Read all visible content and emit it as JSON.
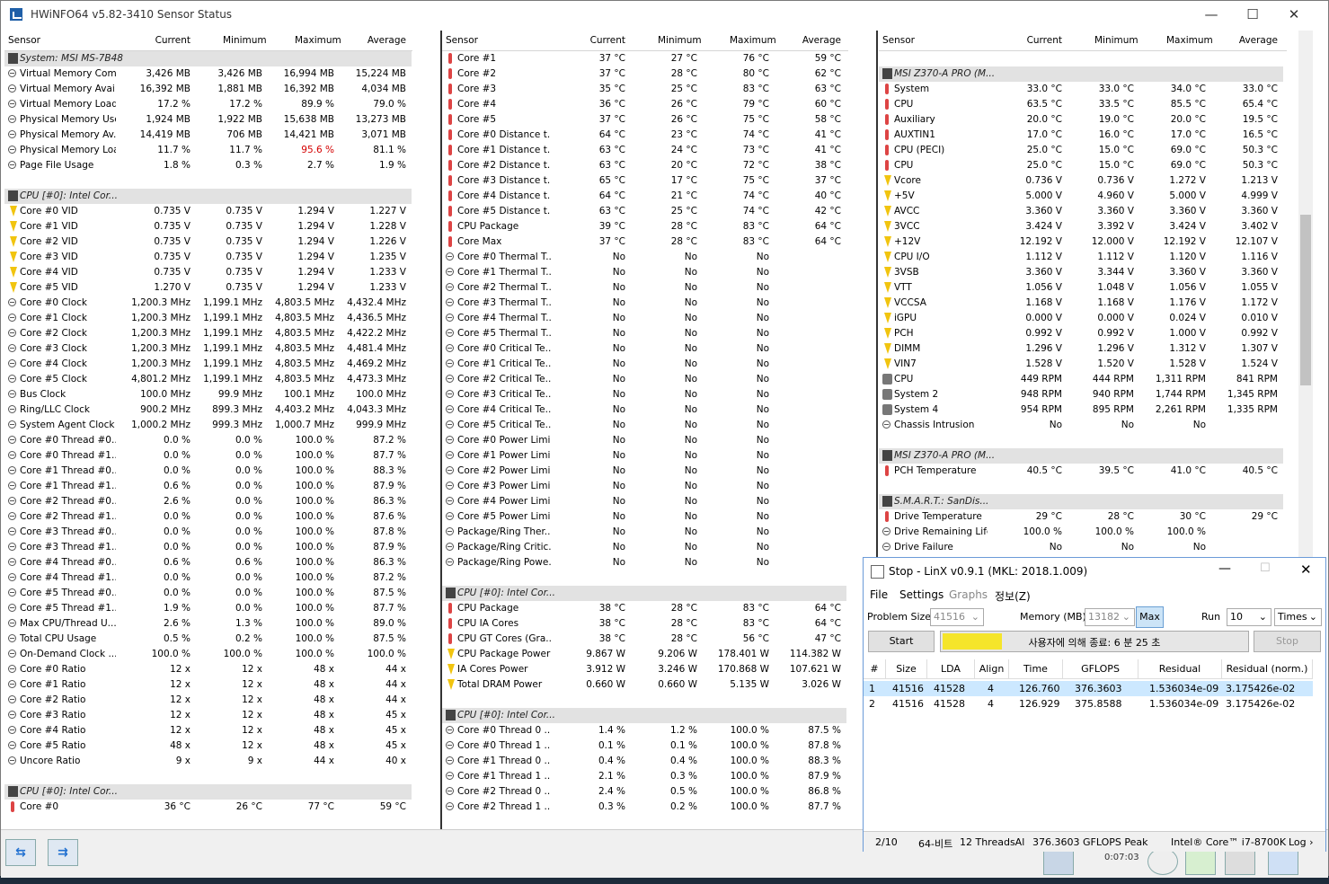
{
  "window": {
    "title": "HWiNFO64 v5.82-3410 Sensor Status",
    "minimize": "—",
    "maximize": "☐",
    "close": "✕"
  },
  "columns": {
    "sensor": "Sensor",
    "current": "Current",
    "minimum": "Minimum",
    "maximum": "Maximum",
    "average": "Average"
  },
  "pane1": [
    {
      "n": "System: MSI MS-7B48",
      "g": 1
    },
    {
      "n": "Virtual Memory Com...",
      "i": "circ",
      "c": "3,426 MB",
      "mn": "3,426 MB",
      "mx": "16,994 MB",
      "a": "15,224 MB"
    },
    {
      "n": "Virtual Memory Avai...",
      "i": "circ",
      "c": "16,392 MB",
      "mn": "1,881 MB",
      "mx": "16,392 MB",
      "a": "4,034 MB"
    },
    {
      "n": "Virtual Memory Load",
      "i": "circ",
      "c": "17.2 %",
      "mn": "17.2 %",
      "mx": "89.9 %",
      "a": "79.0 %"
    },
    {
      "n": "Physical Memory Used",
      "i": "circ",
      "c": "1,924 MB",
      "mn": "1,922 MB",
      "mx": "15,638 MB",
      "a": "13,273 MB"
    },
    {
      "n": "Physical Memory Av...",
      "i": "circ",
      "c": "14,419 MB",
      "mn": "706 MB",
      "mx": "14,421 MB",
      "a": "3,071 MB"
    },
    {
      "n": "Physical Memory Load",
      "i": "circ",
      "c": "11.7 %",
      "mn": "11.7 %",
      "mx": "95.6 %",
      "a": "81.1 %",
      "mxred": 1
    },
    {
      "n": "Page File Usage",
      "i": "circ",
      "c": "1.8 %",
      "mn": "0.3 %",
      "mx": "2.7 %",
      "a": "1.9 %"
    },
    {
      "n": "",
      "e": 1
    },
    {
      "n": "CPU [#0]: Intel Cor...",
      "g": 1
    },
    {
      "n": "Core #0 VID",
      "i": "volt",
      "c": "0.735 V",
      "mn": "0.735 V",
      "mx": "1.294 V",
      "a": "1.227 V"
    },
    {
      "n": "Core #1 VID",
      "i": "volt",
      "c": "0.735 V",
      "mn": "0.735 V",
      "mx": "1.294 V",
      "a": "1.228 V"
    },
    {
      "n": "Core #2 VID",
      "i": "volt",
      "c": "0.735 V",
      "mn": "0.735 V",
      "mx": "1.294 V",
      "a": "1.226 V"
    },
    {
      "n": "Core #3 VID",
      "i": "volt",
      "c": "0.735 V",
      "mn": "0.735 V",
      "mx": "1.294 V",
      "a": "1.235 V"
    },
    {
      "n": "Core #4 VID",
      "i": "volt",
      "c": "0.735 V",
      "mn": "0.735 V",
      "mx": "1.294 V",
      "a": "1.233 V"
    },
    {
      "n": "Core #5 VID",
      "i": "volt",
      "c": "1.270 V",
      "mn": "0.735 V",
      "mx": "1.294 V",
      "a": "1.233 V"
    },
    {
      "n": "Core #0 Clock",
      "i": "circ",
      "c": "1,200.3 MHz",
      "mn": "1,199.1 MHz",
      "mx": "4,803.5 MHz",
      "a": "4,432.4 MHz"
    },
    {
      "n": "Core #1 Clock",
      "i": "circ",
      "c": "1,200.3 MHz",
      "mn": "1,199.1 MHz",
      "mx": "4,803.5 MHz",
      "a": "4,436.5 MHz"
    },
    {
      "n": "Core #2 Clock",
      "i": "circ",
      "c": "1,200.3 MHz",
      "mn": "1,199.1 MHz",
      "mx": "4,803.5 MHz",
      "a": "4,422.2 MHz"
    },
    {
      "n": "Core #3 Clock",
      "i": "circ",
      "c": "1,200.3 MHz",
      "mn": "1,199.1 MHz",
      "mx": "4,803.5 MHz",
      "a": "4,481.4 MHz"
    },
    {
      "n": "Core #4 Clock",
      "i": "circ",
      "c": "1,200.3 MHz",
      "mn": "1,199.1 MHz",
      "mx": "4,803.5 MHz",
      "a": "4,469.2 MHz"
    },
    {
      "n": "Core #5 Clock",
      "i": "circ",
      "c": "4,801.2 MHz",
      "mn": "1,199.1 MHz",
      "mx": "4,803.5 MHz",
      "a": "4,473.3 MHz"
    },
    {
      "n": "Bus Clock",
      "i": "circ",
      "c": "100.0 MHz",
      "mn": "99.9 MHz",
      "mx": "100.1 MHz",
      "a": "100.0 MHz"
    },
    {
      "n": "Ring/LLC Clock",
      "i": "circ",
      "c": "900.2 MHz",
      "mn": "899.3 MHz",
      "mx": "4,403.2 MHz",
      "a": "4,043.3 MHz"
    },
    {
      "n": "System Agent Clock",
      "i": "circ",
      "c": "1,000.2 MHz",
      "mn": "999.3 MHz",
      "mx": "1,000.7 MHz",
      "a": "999.9 MHz"
    },
    {
      "n": "Core #0 Thread #0...",
      "i": "circ",
      "c": "0.0 %",
      "mn": "0.0 %",
      "mx": "100.0 %",
      "a": "87.2 %"
    },
    {
      "n": "Core #0 Thread #1...",
      "i": "circ",
      "c": "0.0 %",
      "mn": "0.0 %",
      "mx": "100.0 %",
      "a": "87.7 %"
    },
    {
      "n": "Core #1 Thread #0...",
      "i": "circ",
      "c": "0.0 %",
      "mn": "0.0 %",
      "mx": "100.0 %",
      "a": "88.3 %"
    },
    {
      "n": "Core #1 Thread #1...",
      "i": "circ",
      "c": "0.6 %",
      "mn": "0.0 %",
      "mx": "100.0 %",
      "a": "87.9 %"
    },
    {
      "n": "Core #2 Thread #0...",
      "i": "circ",
      "c": "2.6 %",
      "mn": "0.0 %",
      "mx": "100.0 %",
      "a": "86.3 %"
    },
    {
      "n": "Core #2 Thread #1...",
      "i": "circ",
      "c": "0.0 %",
      "mn": "0.0 %",
      "mx": "100.0 %",
      "a": "87.6 %"
    },
    {
      "n": "Core #3 Thread #0...",
      "i": "circ",
      "c": "0.0 %",
      "mn": "0.0 %",
      "mx": "100.0 %",
      "a": "87.8 %"
    },
    {
      "n": "Core #3 Thread #1...",
      "i": "circ",
      "c": "0.0 %",
      "mn": "0.0 %",
      "mx": "100.0 %",
      "a": "87.9 %"
    },
    {
      "n": "Core #4 Thread #0...",
      "i": "circ",
      "c": "0.6 %",
      "mn": "0.6 %",
      "mx": "100.0 %",
      "a": "86.3 %"
    },
    {
      "n": "Core #4 Thread #1...",
      "i": "circ",
      "c": "0.0 %",
      "mn": "0.0 %",
      "mx": "100.0 %",
      "a": "87.2 %"
    },
    {
      "n": "Core #5 Thread #0...",
      "i": "circ",
      "c": "0.0 %",
      "mn": "0.0 %",
      "mx": "100.0 %",
      "a": "87.5 %"
    },
    {
      "n": "Core #5 Thread #1...",
      "i": "circ",
      "c": "1.9 %",
      "mn": "0.0 %",
      "mx": "100.0 %",
      "a": "87.7 %"
    },
    {
      "n": "Max CPU/Thread U...",
      "i": "circ",
      "c": "2.6 %",
      "mn": "1.3 %",
      "mx": "100.0 %",
      "a": "89.0 %"
    },
    {
      "n": "Total CPU Usage",
      "i": "circ",
      "c": "0.5 %",
      "mn": "0.2 %",
      "mx": "100.0 %",
      "a": "87.5 %"
    },
    {
      "n": "On-Demand Clock ...",
      "i": "circ",
      "c": "100.0 %",
      "mn": "100.0 %",
      "mx": "100.0 %",
      "a": "100.0 %"
    },
    {
      "n": "Core #0 Ratio",
      "i": "circ",
      "c": "12 x",
      "mn": "12 x",
      "mx": "48 x",
      "a": "44 x"
    },
    {
      "n": "Core #1 Ratio",
      "i": "circ",
      "c": "12 x",
      "mn": "12 x",
      "mx": "48 x",
      "a": "44 x"
    },
    {
      "n": "Core #2 Ratio",
      "i": "circ",
      "c": "12 x",
      "mn": "12 x",
      "mx": "48 x",
      "a": "44 x"
    },
    {
      "n": "Core #3 Ratio",
      "i": "circ",
      "c": "12 x",
      "mn": "12 x",
      "mx": "48 x",
      "a": "45 x"
    },
    {
      "n": "Core #4 Ratio",
      "i": "circ",
      "c": "12 x",
      "mn": "12 x",
      "mx": "48 x",
      "a": "45 x"
    },
    {
      "n": "Core #5 Ratio",
      "i": "circ",
      "c": "48 x",
      "mn": "12 x",
      "mx": "48 x",
      "a": "45 x"
    },
    {
      "n": "Uncore Ratio",
      "i": "circ",
      "c": "9 x",
      "mn": "9 x",
      "mx": "44 x",
      "a": "40 x"
    },
    {
      "n": "",
      "e": 1
    },
    {
      "n": "CPU [#0]: Intel Cor...",
      "g": 1
    },
    {
      "n": "Core #0",
      "i": "therm",
      "c": "36 °C",
      "mn": "26 °C",
      "mx": "77 °C",
      "a": "59 °C"
    }
  ],
  "pane2": [
    {
      "n": "Core #1",
      "i": "therm",
      "c": "37 °C",
      "mn": "27 °C",
      "mx": "76 °C",
      "a": "59 °C"
    },
    {
      "n": "Core #2",
      "i": "therm",
      "c": "37 °C",
      "mn": "28 °C",
      "mx": "80 °C",
      "a": "62 °C"
    },
    {
      "n": "Core #3",
      "i": "therm",
      "c": "35 °C",
      "mn": "25 °C",
      "mx": "83 °C",
      "a": "63 °C"
    },
    {
      "n": "Core #4",
      "i": "therm",
      "c": "36 °C",
      "mn": "26 °C",
      "mx": "79 °C",
      "a": "60 °C"
    },
    {
      "n": "Core #5",
      "i": "therm",
      "c": "37 °C",
      "mn": "26 °C",
      "mx": "75 °C",
      "a": "58 °C"
    },
    {
      "n": "Core #0 Distance t...",
      "i": "therm",
      "c": "64 °C",
      "mn": "23 °C",
      "mx": "74 °C",
      "a": "41 °C"
    },
    {
      "n": "Core #1 Distance t...",
      "i": "therm",
      "c": "63 °C",
      "mn": "24 °C",
      "mx": "73 °C",
      "a": "41 °C"
    },
    {
      "n": "Core #2 Distance t...",
      "i": "therm",
      "c": "63 °C",
      "mn": "20 °C",
      "mx": "72 °C",
      "a": "38 °C"
    },
    {
      "n": "Core #3 Distance t...",
      "i": "therm",
      "c": "65 °C",
      "mn": "17 °C",
      "mx": "75 °C",
      "a": "37 °C"
    },
    {
      "n": "Core #4 Distance t...",
      "i": "therm",
      "c": "64 °C",
      "mn": "21 °C",
      "mx": "74 °C",
      "a": "40 °C"
    },
    {
      "n": "Core #5 Distance t...",
      "i": "therm",
      "c": "63 °C",
      "mn": "25 °C",
      "mx": "74 °C",
      "a": "42 °C"
    },
    {
      "n": "CPU Package",
      "i": "therm",
      "c": "39 °C",
      "mn": "28 °C",
      "mx": "83 °C",
      "a": "64 °C"
    },
    {
      "n": "Core Max",
      "i": "therm",
      "c": "37 °C",
      "mn": "28 °C",
      "mx": "83 °C",
      "a": "64 °C"
    },
    {
      "n": "Core #0 Thermal T...",
      "i": "circ",
      "c": "No",
      "mn": "No",
      "mx": "No",
      "a": ""
    },
    {
      "n": "Core #1 Thermal T...",
      "i": "circ",
      "c": "No",
      "mn": "No",
      "mx": "No",
      "a": ""
    },
    {
      "n": "Core #2 Thermal T...",
      "i": "circ",
      "c": "No",
      "mn": "No",
      "mx": "No",
      "a": ""
    },
    {
      "n": "Core #3 Thermal T...",
      "i": "circ",
      "c": "No",
      "mn": "No",
      "mx": "No",
      "a": ""
    },
    {
      "n": "Core #4 Thermal T...",
      "i": "circ",
      "c": "No",
      "mn": "No",
      "mx": "No",
      "a": ""
    },
    {
      "n": "Core #5 Thermal T...",
      "i": "circ",
      "c": "No",
      "mn": "No",
      "mx": "No",
      "a": ""
    },
    {
      "n": "Core #0 Critical Te...",
      "i": "circ",
      "c": "No",
      "mn": "No",
      "mx": "No",
      "a": ""
    },
    {
      "n": "Core #1 Critical Te...",
      "i": "circ",
      "c": "No",
      "mn": "No",
      "mx": "No",
      "a": ""
    },
    {
      "n": "Core #2 Critical Te...",
      "i": "circ",
      "c": "No",
      "mn": "No",
      "mx": "No",
      "a": ""
    },
    {
      "n": "Core #3 Critical Te...",
      "i": "circ",
      "c": "No",
      "mn": "No",
      "mx": "No",
      "a": ""
    },
    {
      "n": "Core #4 Critical Te...",
      "i": "circ",
      "c": "No",
      "mn": "No",
      "mx": "No",
      "a": ""
    },
    {
      "n": "Core #5 Critical Te...",
      "i": "circ",
      "c": "No",
      "mn": "No",
      "mx": "No",
      "a": ""
    },
    {
      "n": "Core #0 Power Limi...",
      "i": "circ",
      "c": "No",
      "mn": "No",
      "mx": "No",
      "a": ""
    },
    {
      "n": "Core #1 Power Limi...",
      "i": "circ",
      "c": "No",
      "mn": "No",
      "mx": "No",
      "a": ""
    },
    {
      "n": "Core #2 Power Limi...",
      "i": "circ",
      "c": "No",
      "mn": "No",
      "mx": "No",
      "a": ""
    },
    {
      "n": "Core #3 Power Limi...",
      "i": "circ",
      "c": "No",
      "mn": "No",
      "mx": "No",
      "a": ""
    },
    {
      "n": "Core #4 Power Limi...",
      "i": "circ",
      "c": "No",
      "mn": "No",
      "mx": "No",
      "a": ""
    },
    {
      "n": "Core #5 Power Limi...",
      "i": "circ",
      "c": "No",
      "mn": "No",
      "mx": "No",
      "a": ""
    },
    {
      "n": "Package/Ring Ther...",
      "i": "circ",
      "c": "No",
      "mn": "No",
      "mx": "No",
      "a": ""
    },
    {
      "n": "Package/Ring Critic...",
      "i": "circ",
      "c": "No",
      "mn": "No",
      "mx": "No",
      "a": ""
    },
    {
      "n": "Package/Ring Powe...",
      "i": "circ",
      "c": "No",
      "mn": "No",
      "mx": "No",
      "a": ""
    },
    {
      "n": "",
      "e": 1
    },
    {
      "n": "CPU [#0]: Intel Cor...",
      "g": 1
    },
    {
      "n": "CPU Package",
      "i": "therm",
      "c": "38 °C",
      "mn": "28 °C",
      "mx": "83 °C",
      "a": "64 °C"
    },
    {
      "n": "CPU IA Cores",
      "i": "therm",
      "c": "38 °C",
      "mn": "28 °C",
      "mx": "83 °C",
      "a": "64 °C"
    },
    {
      "n": "CPU GT Cores (Gra...",
      "i": "therm",
      "c": "38 °C",
      "mn": "28 °C",
      "mx": "56 °C",
      "a": "47 °C"
    },
    {
      "n": "CPU Package Power",
      "i": "volt",
      "c": "9.867 W",
      "mn": "9.206 W",
      "mx": "178.401 W",
      "a": "114.382 W"
    },
    {
      "n": "IA Cores Power",
      "i": "volt",
      "c": "3.912 W",
      "mn": "3.246 W",
      "mx": "170.868 W",
      "a": "107.621 W"
    },
    {
      "n": "Total DRAM Power",
      "i": "volt",
      "c": "0.660 W",
      "mn": "0.660 W",
      "mx": "5.135 W",
      "a": "3.026 W"
    },
    {
      "n": "",
      "e": 1
    },
    {
      "n": "CPU [#0]: Intel Cor...",
      "g": 1
    },
    {
      "n": "Core #0 Thread 0 ...",
      "i": "circ",
      "c": "1.4 %",
      "mn": "1.2 %",
      "mx": "100.0 %",
      "a": "87.5 %"
    },
    {
      "n": "Core #0 Thread 1 ...",
      "i": "circ",
      "c": "0.1 %",
      "mn": "0.1 %",
      "mx": "100.0 %",
      "a": "87.8 %"
    },
    {
      "n": "Core #1 Thread 0 ...",
      "i": "circ",
      "c": "0.4 %",
      "mn": "0.4 %",
      "mx": "100.0 %",
      "a": "88.3 %"
    },
    {
      "n": "Core #1 Thread 1 ...",
      "i": "circ",
      "c": "2.1 %",
      "mn": "0.3 %",
      "mx": "100.0 %",
      "a": "87.9 %"
    },
    {
      "n": "Core #2 Thread 0 ...",
      "i": "circ",
      "c": "2.4 %",
      "mn": "0.5 %",
      "mx": "100.0 %",
      "a": "86.8 %"
    },
    {
      "n": "Core #2 Thread 1 ...",
      "i": "circ",
      "c": "0.3 %",
      "mn": "0.2 %",
      "mx": "100.0 %",
      "a": "87.7 %"
    }
  ],
  "pane3": [
    {
      "n": "",
      "e": 1
    },
    {
      "n": "MSI Z370-A PRO (M...",
      "g": 1
    },
    {
      "n": "System",
      "i": "therm",
      "c": "33.0 °C",
      "mn": "33.0 °C",
      "mx": "34.0 °C",
      "a": "33.0 °C"
    },
    {
      "n": "CPU",
      "i": "therm",
      "c": "63.5 °C",
      "mn": "33.5 °C",
      "mx": "85.5 °C",
      "a": "65.4 °C"
    },
    {
      "n": "Auxiliary",
      "i": "therm",
      "c": "20.0 °C",
      "mn": "19.0 °C",
      "mx": "20.0 °C",
      "a": "19.5 °C"
    },
    {
      "n": "AUXTIN1",
      "i": "therm",
      "c": "17.0 °C",
      "mn": "16.0 °C",
      "mx": "17.0 °C",
      "a": "16.5 °C"
    },
    {
      "n": "CPU (PECI)",
      "i": "therm",
      "c": "25.0 °C",
      "mn": "15.0 °C",
      "mx": "69.0 °C",
      "a": "50.3 °C"
    },
    {
      "n": "CPU",
      "i": "therm",
      "c": "25.0 °C",
      "mn": "15.0 °C",
      "mx": "69.0 °C",
      "a": "50.3 °C"
    },
    {
      "n": "Vcore",
      "i": "volt",
      "c": "0.736 V",
      "mn": "0.736 V",
      "mx": "1.272 V",
      "a": "1.213 V"
    },
    {
      "n": "+5V",
      "i": "volt",
      "c": "5.000 V",
      "mn": "4.960 V",
      "mx": "5.000 V",
      "a": "4.999 V"
    },
    {
      "n": "AVCC",
      "i": "volt",
      "c": "3.360 V",
      "mn": "3.360 V",
      "mx": "3.360 V",
      "a": "3.360 V"
    },
    {
      "n": "3VCC",
      "i": "volt",
      "c": "3.424 V",
      "mn": "3.392 V",
      "mx": "3.424 V",
      "a": "3.402 V"
    },
    {
      "n": "+12V",
      "i": "volt",
      "c": "12.192 V",
      "mn": "12.000 V",
      "mx": "12.192 V",
      "a": "12.107 V"
    },
    {
      "n": "CPU I/O",
      "i": "volt",
      "c": "1.112 V",
      "mn": "1.112 V",
      "mx": "1.120 V",
      "a": "1.116 V"
    },
    {
      "n": "3VSB",
      "i": "volt",
      "c": "3.360 V",
      "mn": "3.344 V",
      "mx": "3.360 V",
      "a": "3.360 V"
    },
    {
      "n": "VTT",
      "i": "volt",
      "c": "1.056 V",
      "mn": "1.048 V",
      "mx": "1.056 V",
      "a": "1.055 V"
    },
    {
      "n": "VCCSA",
      "i": "volt",
      "c": "1.168 V",
      "mn": "1.168 V",
      "mx": "1.176 V",
      "a": "1.172 V"
    },
    {
      "n": "iGPU",
      "i": "volt",
      "c": "0.000 V",
      "mn": "0.000 V",
      "mx": "0.024 V",
      "a": "0.010 V"
    },
    {
      "n": "PCH",
      "i": "volt",
      "c": "0.992 V",
      "mn": "0.992 V",
      "mx": "1.000 V",
      "a": "0.992 V"
    },
    {
      "n": "DIMM",
      "i": "volt",
      "c": "1.296 V",
      "mn": "1.296 V",
      "mx": "1.312 V",
      "a": "1.307 V"
    },
    {
      "n": "VIN7",
      "i": "volt",
      "c": "1.528 V",
      "mn": "1.520 V",
      "mx": "1.528 V",
      "a": "1.524 V"
    },
    {
      "n": "CPU",
      "i": "fan",
      "c": "449 RPM",
      "mn": "444 RPM",
      "mx": "1,311 RPM",
      "a": "841 RPM"
    },
    {
      "n": "System 2",
      "i": "fan",
      "c": "948 RPM",
      "mn": "940 RPM",
      "mx": "1,744 RPM",
      "a": "1,345 RPM"
    },
    {
      "n": "System 4",
      "i": "fan",
      "c": "954 RPM",
      "mn": "895 RPM",
      "mx": "2,261 RPM",
      "a": "1,335 RPM"
    },
    {
      "n": "Chassis Intrusion",
      "i": "circ",
      "c": "No",
      "mn": "No",
      "mx": "No",
      "a": ""
    },
    {
      "n": "",
      "e": 1
    },
    {
      "n": "MSI Z370-A PRO (M...",
      "g": 1
    },
    {
      "n": "PCH Temperature",
      "i": "therm",
      "c": "40.5 °C",
      "mn": "39.5 °C",
      "mx": "41.0 °C",
      "a": "40.5 °C"
    },
    {
      "n": "",
      "e": 1
    },
    {
      "n": "S.M.A.R.T.: SanDis...",
      "g": 1
    },
    {
      "n": "Drive Temperature",
      "i": "therm",
      "c": "29 °C",
      "mn": "28 °C",
      "mx": "30 °C",
      "a": "29 °C"
    },
    {
      "n": "Drive Remaining Life",
      "i": "circ",
      "c": "100.0 %",
      "mn": "100.0 %",
      "mx": "100.0 %",
      "a": ""
    },
    {
      "n": "Drive Failure",
      "i": "circ",
      "c": "No",
      "mn": "No",
      "mx": "No",
      "a": ""
    }
  ],
  "statusbar": {
    "clock": "0:07:03"
  },
  "linx": {
    "title": "Stop - LinX v0.9.1 (MKL: 2018.1.009)",
    "menu": [
      "File",
      "Settings",
      "Graphs",
      "정보(Z)"
    ],
    "problem_size_label": "Problem Size:",
    "problem_size": "41516",
    "memory_label": "Memory (MB):",
    "memory": "13182",
    "max_button": "Max",
    "run_label": "Run",
    "run_count": "10",
    "run_unit": "Times",
    "start_button": "Start",
    "progress_text": "사용자에 의해 종료: 6 분 25 초",
    "progress_color": "#f5e52a",
    "stop_button": "Stop",
    "table_headers": [
      "#",
      "Size",
      "LDA",
      "Align",
      "Time",
      "GFLOPS",
      "Residual",
      "Residual (norm.)"
    ],
    "rows": [
      [
        "1",
        "41516",
        "41528",
        "4",
        "126.760",
        "376.3603",
        "1.536034e-09",
        "3.175426e-02"
      ],
      [
        "2",
        "41516",
        "41528",
        "4",
        "126.929",
        "375.8588",
        "1.536034e-09",
        "3.175426e-02"
      ]
    ],
    "status": {
      "progress": "2/10",
      "bits": "64-비트",
      "threads": "12 ThreadsAl",
      "peak": "376.3603 GFLOPS Peak",
      "cpu": "Intel® Core™ i7-8700K",
      "log": "Log ›"
    }
  }
}
